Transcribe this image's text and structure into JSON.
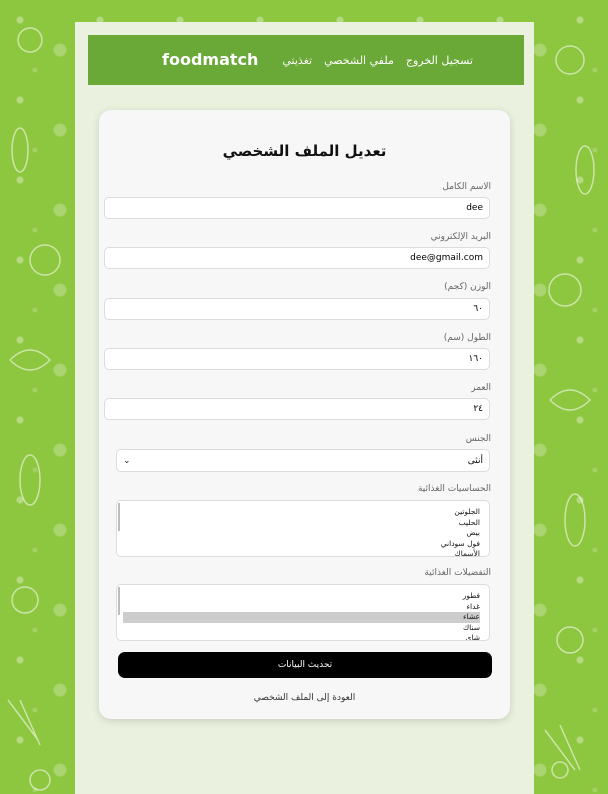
{
  "navbar": {
    "brand": "foodmatch",
    "links": [
      "تسجيل الخروج",
      "ملفي الشخصي",
      "تغذيتي"
    ]
  },
  "form": {
    "title": "تعديل الملف الشخصي",
    "fields": {
      "name": {
        "label": "الاسم الكامل",
        "value": "dee"
      },
      "email": {
        "label": "البريد الإلكتروني",
        "value": "dee@gmail.com"
      },
      "weight": {
        "label": "الوزن (كجم)",
        "value": "٦٠"
      },
      "height": {
        "label": "الطول (سم)",
        "value": "١٦٠"
      },
      "age": {
        "label": "العمر",
        "value": "٢٤"
      },
      "gender": {
        "label": "الجنس",
        "value": "أنثى"
      }
    },
    "allergies": {
      "label": "الحساسيات الغذائية",
      "options": [
        "الجلوتين",
        "الحليب",
        "بيض",
        "فول سوداني",
        "الأسماك"
      ]
    },
    "preferences": {
      "label": "التفضيلات الغذائية",
      "options": [
        "فطور",
        "غداء",
        "عشاء",
        "سناك",
        "شاي"
      ],
      "selected_index": 2
    },
    "submit_label": "تحديث البيانات",
    "back_link": "العودة إلى الملف الشخصي"
  },
  "colors": {
    "background": "#8dc63f",
    "navbar": "#6aa838",
    "container": "#eaf2df",
    "card": "#f7f7f7",
    "button": "#000000"
  }
}
